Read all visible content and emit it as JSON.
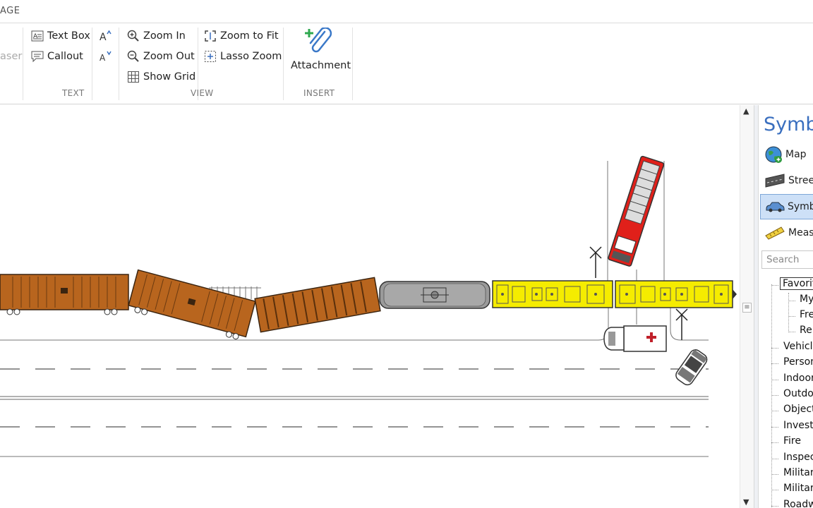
{
  "window": {
    "title_fragment": "AGE"
  },
  "ribbon": {
    "eraser_fragment": "aser",
    "text_group": {
      "label": "TEXT",
      "text_box": "Text Box",
      "callout": "Callout"
    },
    "view_group": {
      "label": "VIEW",
      "zoom_in": "Zoom In",
      "zoom_out": "Zoom Out",
      "show_grid": "Show Grid",
      "zoom_to_fit": "Zoom to Fit",
      "lasso_zoom": "Lasso Zoom"
    },
    "insert_group": {
      "label": "INSERT",
      "attachment": "Attachment"
    }
  },
  "panel": {
    "title": "Symbo",
    "nav": [
      {
        "label": "Map",
        "icon": "globe-icon"
      },
      {
        "label": "Street",
        "icon": "street-icon"
      },
      {
        "label": "Symbo",
        "icon": "car-icon",
        "active": true
      },
      {
        "label": "Measu",
        "icon": "ruler-icon"
      }
    ],
    "search_placeholder": "Search",
    "tree": {
      "favorites": "Favorit",
      "favorites_children": [
        "My",
        "Fre",
        "Re"
      ],
      "categories": [
        "Vehicle",
        "Person",
        "Indoor",
        "Outdo",
        "Object",
        "Investi",
        "Fire",
        "Inspec",
        "Militar",
        "Militar",
        "Roadw"
      ]
    }
  },
  "colors": {
    "accent_blue": "#3a6fbf",
    "boxcar_brown": "#b8651e",
    "locomotive_yellow": "#f5ec00",
    "tanker_gray": "#9a9a9a",
    "fire_truck_red": "#e0201a"
  }
}
